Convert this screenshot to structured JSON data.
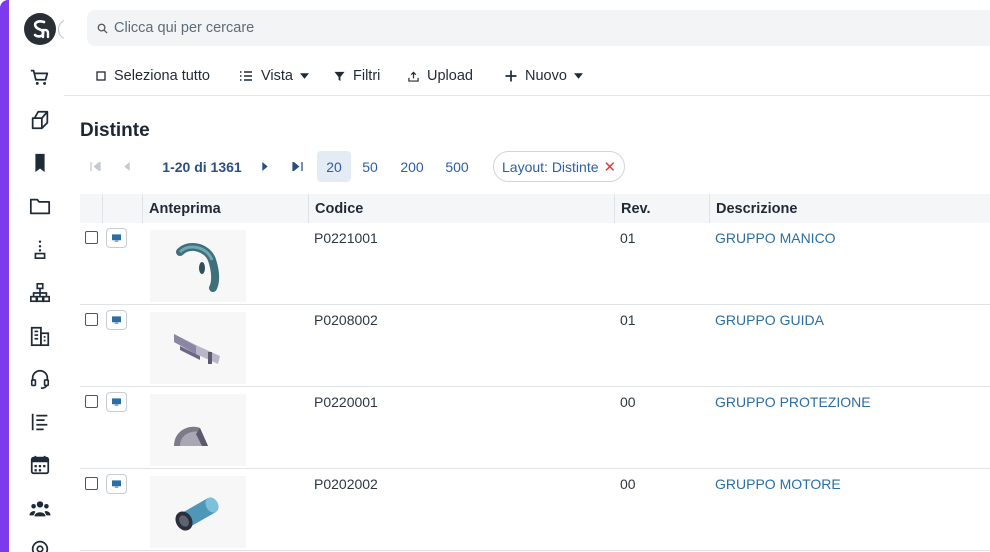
{
  "search": {
    "placeholder": "Clicca qui per cercare"
  },
  "toolbar": {
    "select_all": "Seleziona tutto",
    "view": "Vista",
    "filters": "Filtri",
    "upload": "Upload",
    "new": "Nuovo"
  },
  "page": {
    "title": "Distinte"
  },
  "pager": {
    "info": "1-20 di 1361",
    "sizes": [
      "20",
      "50",
      "200",
      "500"
    ],
    "active_size": "20",
    "layout_chip": "Layout: Distinte",
    "layout_chip_close": "✕"
  },
  "table": {
    "columns": [
      "Anteprima",
      "Codice",
      "Rev.",
      "Descrizione"
    ],
    "rows": [
      {
        "codice": "P0221001",
        "rev": "01",
        "descrizione": "GRUPPO MANICO"
      },
      {
        "codice": "P0208002",
        "rev": "01",
        "descrizione": "GRUPPO GUIDA"
      },
      {
        "codice": "P0220001",
        "rev": "00",
        "descrizione": "GRUPPO PROTEZIONE"
      },
      {
        "codice": "P0202002",
        "rev": "00",
        "descrizione": "GRUPPO MOTORE"
      }
    ]
  },
  "sidebar": {
    "icons": [
      "logo-icon",
      "cart-icon",
      "boxes-icon",
      "bookmark-icon",
      "folder-icon",
      "tree-list-icon",
      "hierarchy-icon",
      "building-icon",
      "headset-icon",
      "list-icon",
      "calendar-icon",
      "users-icon",
      "settings-icon"
    ]
  },
  "colors": {
    "accent": "#7c3aed",
    "link": "#2b6ea3",
    "close": "#e03c3c"
  }
}
